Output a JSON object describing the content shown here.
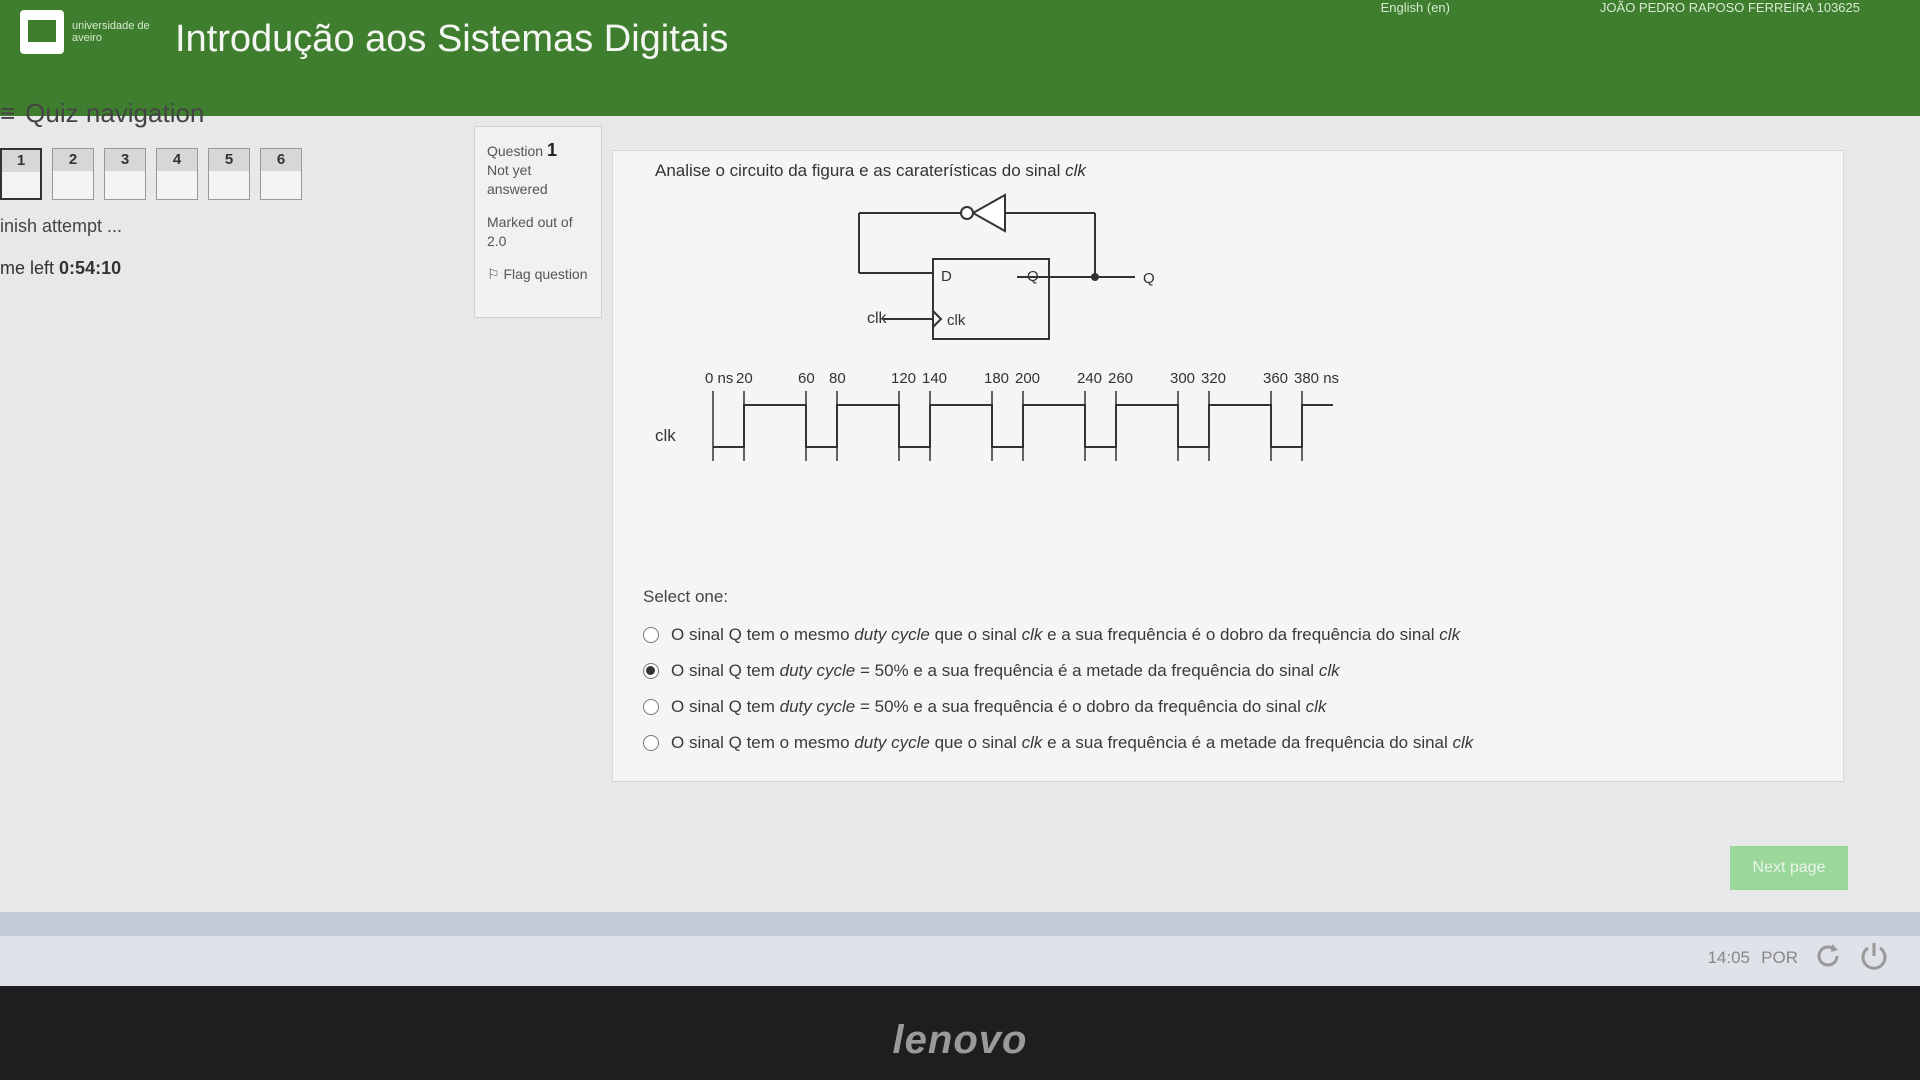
{
  "header": {
    "university": "universidade de aveiro",
    "course_title": "Introdução aos Sistemas Digitais",
    "language": "English (en)",
    "user_name": "JOÃO PEDRO RAPOSO FERREIRA 103625"
  },
  "quiz_nav": {
    "title": "Quiz navigation",
    "questions": [
      "1",
      "2",
      "3",
      "4",
      "5",
      "6"
    ],
    "finish_attempt": "inish attempt ...",
    "time_left_label": "me left",
    "time_left_value": "0:54:10"
  },
  "question_info": {
    "label": "Question",
    "number": "1",
    "status": "Not yet answered",
    "marked": "Marked out of 2.0",
    "flag": "Flag question"
  },
  "question": {
    "prompt": "Analise o circuito da figura e as caraterísticas do sinal",
    "prompt_signal": "clk",
    "circuit": {
      "ff_d": "D",
      "ff_q": "Q",
      "ff_clk": "clk",
      "clk_input": "clk",
      "output": "Q"
    },
    "timing": {
      "signal_name": "clk",
      "labels": [
        "0 ns",
        "20",
        "60",
        "80",
        "120",
        "140",
        "180",
        "200",
        "240",
        "260",
        "300",
        "320",
        "360",
        "380 ns"
      ]
    },
    "select_one": "Select one:",
    "options": [
      {
        "text_a": "O sinal Q tem o mesmo ",
        "em": "duty cycle",
        "text_b": " que o sinal ",
        "em2": "clk",
        "text_c": " e a sua frequência é o dobro da frequência do sinal ",
        "em3": "clk",
        "checked": false
      },
      {
        "text_a": "O sinal Q tem ",
        "em": "duty cycle",
        "text_b": " = 50% e a sua frequência é a metade da frequência do sinal ",
        "em2": "clk",
        "text_c": "",
        "em3": "",
        "checked": true
      },
      {
        "text_a": "O sinal Q tem ",
        "em": "duty cycle",
        "text_b": " = 50% e a sua frequência é o dobro da frequência do sinal ",
        "em2": "clk",
        "text_c": "",
        "em3": "",
        "checked": false
      },
      {
        "text_a": "O sinal Q tem o mesmo ",
        "em": "duty cycle",
        "text_b": " que o sinal ",
        "em2": "clk",
        "text_c": " e a sua frequência é a metade da frequência do sinal ",
        "em3": "clk",
        "checked": false
      }
    ]
  },
  "next_button": "Next page",
  "taskbar": {
    "clock": "14:05",
    "lang": "POR",
    "refresh_icon": "refresh-icon",
    "power_icon": "power-icon"
  },
  "monitor_brand": "lenovo",
  "colors": {
    "header_green": "#3f7e2f",
    "next_button": "#9bd69a"
  }
}
